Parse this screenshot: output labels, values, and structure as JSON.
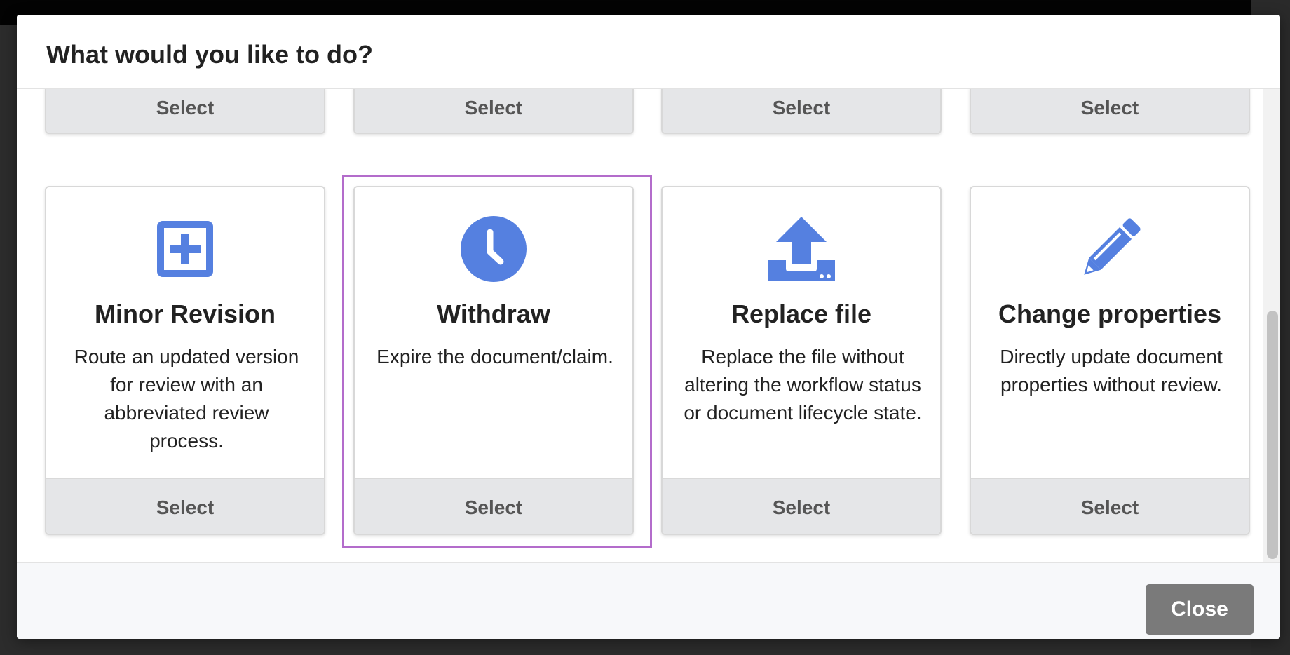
{
  "modal": {
    "title": "What would you like to do?",
    "close_label": "Close"
  },
  "top_row": [
    {
      "select_label": "Select"
    },
    {
      "select_label": "Select"
    },
    {
      "select_label": "Select"
    },
    {
      "select_label": "Select"
    }
  ],
  "cards": [
    {
      "title": "Minor Revision",
      "description": "Route an updated version for review with an abbreviated review process.",
      "icon": "plus-square-icon",
      "select_label": "Select"
    },
    {
      "title": "Withdraw",
      "description": "Expire the document/claim.",
      "icon": "clock-icon",
      "select_label": "Select"
    },
    {
      "title": "Replace file",
      "description": "Replace the file without altering the workflow status or document lifecycle state.",
      "icon": "upload-icon",
      "select_label": "Select"
    },
    {
      "title": "Change properties",
      "description": "Directly update document properties without review.",
      "icon": "pencil-icon",
      "select_label": "Select"
    }
  ],
  "colors": {
    "icon": "#5580e0",
    "focus": "#b36ccb",
    "select_bg": "#e5e6e8",
    "close_bg": "#7a7a7a"
  }
}
